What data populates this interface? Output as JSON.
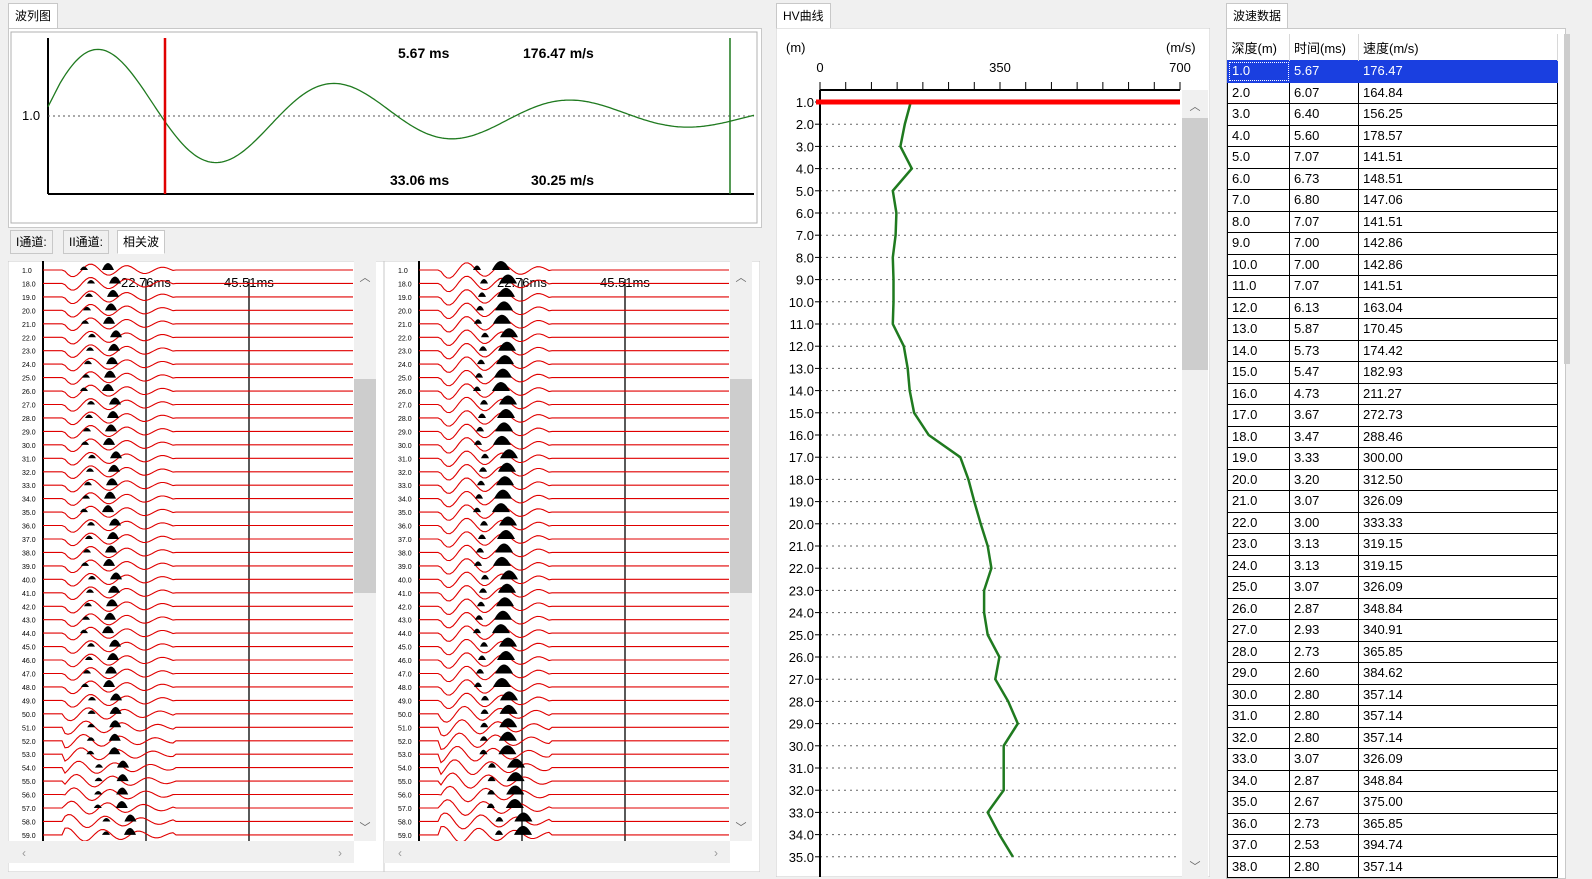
{
  "tabs": {
    "wave": "波列图",
    "hv": "HV曲线",
    "speed": "波速数据"
  },
  "subtabs": [
    "I通道:",
    "II通道:",
    "相关波"
  ],
  "top_chart": {
    "y_label": "1.0",
    "readouts": {
      "time1": "5.67 ms",
      "speed1": "176.47 m/s",
      "time2": "33.06 ms",
      "speed2": "30.25 m/s"
    }
  },
  "wave_panels": {
    "marker1": "22.76ms",
    "marker2": "45.51ms",
    "depth_labels": [
      "1.0",
      "18.0",
      "19.0",
      "20.0",
      "21.0",
      "22.0",
      "23.0",
      "24.0",
      "25.0",
      "26.0",
      "27.0",
      "28.0",
      "29.0",
      "30.0",
      "31.0",
      "32.0",
      "33.0",
      "34.0",
      "35.0",
      "36.0",
      "37.0",
      "38.0",
      "39.0",
      "40.0",
      "41.0",
      "42.0",
      "43.0",
      "44.0",
      "45.0",
      "46.0",
      "47.0",
      "48.0",
      "49.0",
      "50.0",
      "51.0",
      "52.0",
      "53.0",
      "54.0",
      "55.0",
      "56.0",
      "57.0",
      "58.0",
      "59.0"
    ]
  },
  "hv_chart": {
    "y_unit": "(m)",
    "x_unit": "(m/s)",
    "x_ticks": [
      "0",
      "350",
      "700"
    ],
    "x_range": [
      0,
      700
    ],
    "depth_labels": [
      "1.0",
      "2.0",
      "3.0",
      "4.0",
      "5.0",
      "6.0",
      "7.0",
      "8.0",
      "9.0",
      "10.0",
      "11.0",
      "12.0",
      "13.0",
      "14.0",
      "15.0",
      "16.0",
      "17.0",
      "18.0",
      "19.0",
      "20.0",
      "21.0",
      "22.0",
      "23.0",
      "24.0",
      "25.0",
      "26.0",
      "27.0",
      "28.0",
      "29.0",
      "30.0",
      "31.0",
      "32.0",
      "33.0",
      "34.0",
      "35.0"
    ],
    "velocities": [
      176.47,
      164.84,
      156.25,
      178.57,
      141.51,
      148.51,
      147.06,
      141.51,
      142.86,
      142.86,
      141.51,
      163.04,
      170.45,
      174.42,
      182.93,
      211.27,
      272.73,
      288.46,
      300.0,
      312.5,
      326.09,
      333.33,
      319.15,
      319.15,
      326.09,
      348.84,
      340.91,
      365.85,
      384.62,
      357.14,
      357.14,
      357.14,
      326.09,
      348.84,
      375.0
    ],
    "line_color": "#1f7a1f",
    "cursor_color": "#ff0000"
  },
  "speed_table": {
    "headers": [
      "深度(m)",
      "时间(ms)",
      "速度(m/s)"
    ],
    "selected": 0,
    "rows": [
      [
        "1.0",
        "5.67",
        "176.47"
      ],
      [
        "2.0",
        "6.07",
        "164.84"
      ],
      [
        "3.0",
        "6.40",
        "156.25"
      ],
      [
        "4.0",
        "5.60",
        "178.57"
      ],
      [
        "5.0",
        "7.07",
        "141.51"
      ],
      [
        "6.0",
        "6.73",
        "148.51"
      ],
      [
        "7.0",
        "6.80",
        "147.06"
      ],
      [
        "8.0",
        "7.07",
        "141.51"
      ],
      [
        "9.0",
        "7.00",
        "142.86"
      ],
      [
        "10.0",
        "7.00",
        "142.86"
      ],
      [
        "11.0",
        "7.07",
        "141.51"
      ],
      [
        "12.0",
        "6.13",
        "163.04"
      ],
      [
        "13.0",
        "5.87",
        "170.45"
      ],
      [
        "14.0",
        "5.73",
        "174.42"
      ],
      [
        "15.0",
        "5.47",
        "182.93"
      ],
      [
        "16.0",
        "4.73",
        "211.27"
      ],
      [
        "17.0",
        "3.67",
        "272.73"
      ],
      [
        "18.0",
        "3.47",
        "288.46"
      ],
      [
        "19.0",
        "3.33",
        "300.00"
      ],
      [
        "20.0",
        "3.20",
        "312.50"
      ],
      [
        "21.0",
        "3.07",
        "326.09"
      ],
      [
        "22.0",
        "3.00",
        "333.33"
      ],
      [
        "23.0",
        "3.13",
        "319.15"
      ],
      [
        "24.0",
        "3.13",
        "319.15"
      ],
      [
        "25.0",
        "3.07",
        "326.09"
      ],
      [
        "26.0",
        "2.87",
        "348.84"
      ],
      [
        "27.0",
        "2.93",
        "340.91"
      ],
      [
        "28.0",
        "2.73",
        "365.85"
      ],
      [
        "29.0",
        "2.60",
        "384.62"
      ],
      [
        "30.0",
        "2.80",
        "357.14"
      ],
      [
        "31.0",
        "2.80",
        "357.14"
      ],
      [
        "32.0",
        "2.80",
        "357.14"
      ],
      [
        "33.0",
        "3.07",
        "326.09"
      ],
      [
        "34.0",
        "2.87",
        "348.84"
      ],
      [
        "35.0",
        "2.67",
        "375.00"
      ],
      [
        "36.0",
        "2.73",
        "365.85"
      ],
      [
        "37.0",
        "2.53",
        "394.74"
      ],
      [
        "38.0",
        "2.80",
        "357.14"
      ]
    ]
  }
}
